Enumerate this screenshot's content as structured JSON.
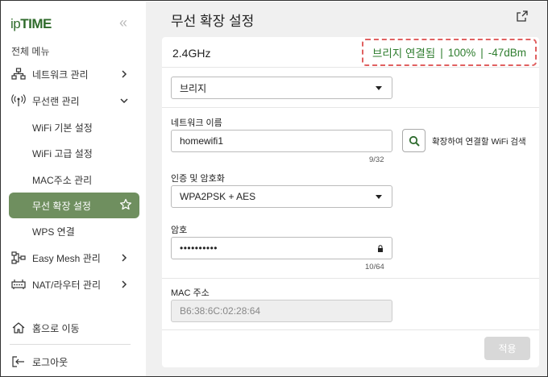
{
  "brand": {
    "logo_prefix": "ip",
    "logo_main": "TIME"
  },
  "sidebar": {
    "menu_title": "전체 메뉴",
    "items": [
      {
        "label": "네트워크 관리"
      },
      {
        "label": "무선랜 관리"
      },
      {
        "label": "WiFi 기본 설정"
      },
      {
        "label": "WiFi 고급 설정"
      },
      {
        "label": "MAC주소 관리"
      },
      {
        "label": "무선 확장 설정"
      },
      {
        "label": "WPS 연결"
      },
      {
        "label": "Easy Mesh 관리"
      },
      {
        "label": "NAT/라우터 관리"
      }
    ],
    "home_label": "홈으로 이동",
    "logout_label": "로그아웃"
  },
  "main": {
    "title": "무선 확장 설정",
    "band": "2.4GHz",
    "status": {
      "state": "브리지 연결됨",
      "signal": "100%",
      "rssi": "-47dBm"
    },
    "mode": {
      "value": "브리지"
    },
    "network_name": {
      "label": "네트워크 이름",
      "value": "homewifi1",
      "counter": "9/32"
    },
    "search_label": "확장하여 연결할 WiFi 검색",
    "auth": {
      "label": "인증 및 암호화",
      "value": "WPA2PSK + AES"
    },
    "password": {
      "label": "암호",
      "value": "••••••••••",
      "counter": "10/64"
    },
    "mac": {
      "label": "MAC 주소",
      "value": "B6:38:6C:02:28:64"
    },
    "apply_label": "적용"
  },
  "colors": {
    "accent": "#6f8f5f",
    "status_text": "#2e7d2e",
    "status_border": "#e06060",
    "logo": "#2f6b2b"
  }
}
